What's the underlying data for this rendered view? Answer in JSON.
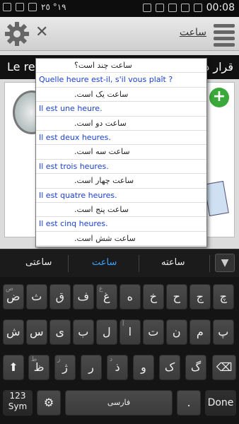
{
  "status": {
    "time": "00:08",
    "left_text": "١٩°  ٢٥"
  },
  "appbar": {
    "title": "ساعت"
  },
  "banner": {
    "left": "Le rer",
    "right": "قرار د"
  },
  "dropdown": [
    {
      "text": "ساعت چند است؟",
      "lang": "fa"
    },
    {
      "text": "Quelle heure est-il, s'il vous plaît ?",
      "lang": "fr"
    },
    {
      "text": "ساعت یک است.",
      "lang": "fa"
    },
    {
      "text": "Il est une heure.",
      "lang": "fr"
    },
    {
      "text": "ساعت دو است.",
      "lang": "fa"
    },
    {
      "text": "Il est deux heures.",
      "lang": "fr"
    },
    {
      "text": "ساعت سه است.",
      "lang": "fa"
    },
    {
      "text": "Il est trois heures.",
      "lang": "fr"
    },
    {
      "text": "ساعت چهار است.",
      "lang": "fa"
    },
    {
      "text": "Il est quatre heures.",
      "lang": "fr"
    },
    {
      "text": "ساعت پنج است.",
      "lang": "fa"
    },
    {
      "text": "Il est cinq heures.",
      "lang": "fr"
    },
    {
      "text": "ساعت شش است.",
      "lang": "fa"
    }
  ],
  "suggestions": {
    "left": "ساعتی",
    "middle": "ساعت",
    "right": "ساعته"
  },
  "keyboard": {
    "row1": [
      {
        "k": "ض",
        "s": "ص"
      },
      {
        "k": "ث",
        "s": ""
      },
      {
        "k": "ق",
        "s": ""
      },
      {
        "k": "ف",
        "s": ""
      },
      {
        "k": "غ",
        "s": "ع"
      },
      {
        "k": "ه",
        "s": ""
      },
      {
        "k": "خ",
        "s": ""
      },
      {
        "k": "ح",
        "s": ""
      },
      {
        "k": "ج",
        "s": ""
      },
      {
        "k": "چ",
        "s": ""
      }
    ],
    "row2": [
      {
        "k": "ش",
        "s": ""
      },
      {
        "k": "س",
        "s": ""
      },
      {
        "k": "ی",
        "s": ""
      },
      {
        "k": "ب",
        "s": ""
      },
      {
        "k": "ل",
        "s": ""
      },
      {
        "k": "ا",
        "s": "آ"
      },
      {
        "k": "ت",
        "s": ""
      },
      {
        "k": "ن",
        "s": ""
      },
      {
        "k": "م",
        "s": ""
      },
      {
        "k": "پ",
        "s": ""
      }
    ],
    "row3": [
      {
        "k": "ظ",
        "s": "ط"
      },
      {
        "k": "ژ",
        "s": "ز"
      },
      {
        "k": "ر",
        "s": ""
      },
      {
        "k": "ذ",
        "s": "د"
      },
      {
        "k": "و",
        "s": ""
      },
      {
        "k": "ک",
        "s": ""
      },
      {
        "k": "گ",
        "s": ""
      }
    ],
    "mode_top": "123",
    "mode_bottom": "Sym",
    "space_label": "فارسی",
    "done": "Done",
    "period": "."
  }
}
